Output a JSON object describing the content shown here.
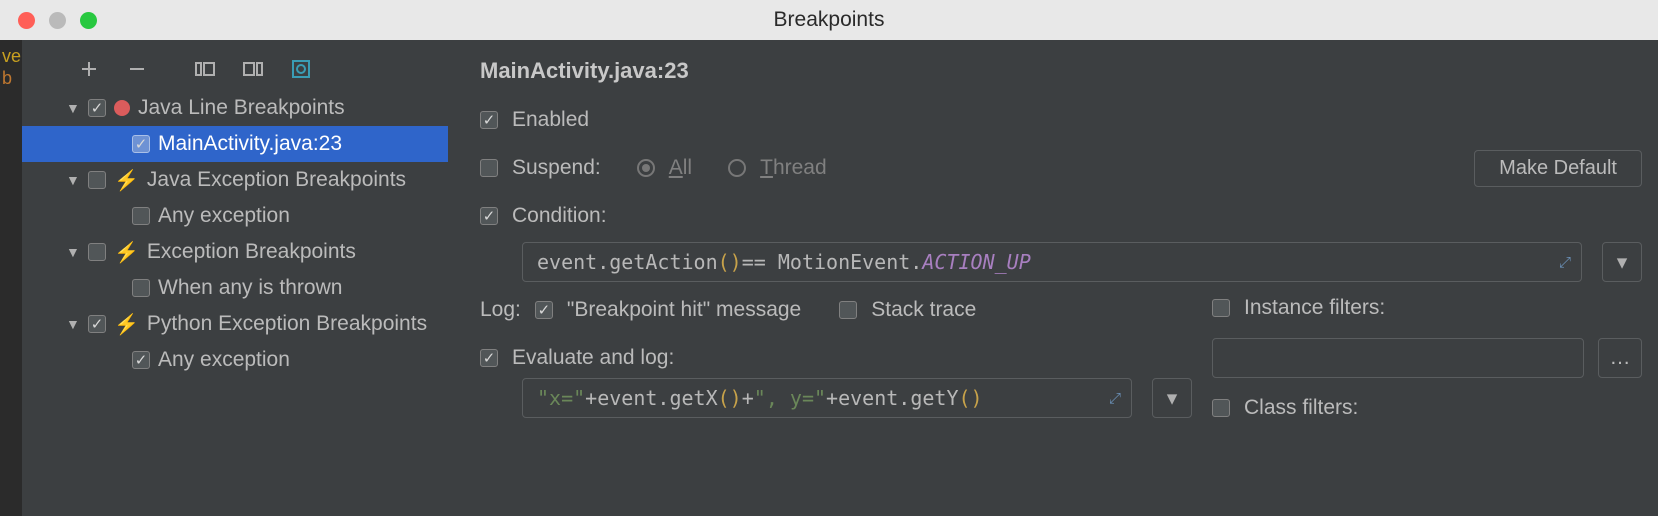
{
  "window": {
    "title": "Breakpoints"
  },
  "gutter": {
    "l1": "ve",
    "l2": "b"
  },
  "toolbar": {
    "add": "+",
    "remove": "−",
    "group": "⧈",
    "view": "⧉",
    "target": "◎"
  },
  "tree": {
    "groups": [
      {
        "label": "Java Line Breakpoints",
        "checked": true,
        "icon": "dot",
        "children": [
          {
            "label": "MainActivity.java:23",
            "checked": true,
            "selected": true
          }
        ]
      },
      {
        "label": "Java Exception Breakpoints",
        "checked": false,
        "icon": "bolt",
        "children": [
          {
            "label": "Any exception",
            "checked": false
          }
        ]
      },
      {
        "label": "Exception Breakpoints",
        "checked": false,
        "icon": "bolt",
        "children": [
          {
            "label": "When any is thrown",
            "checked": false
          }
        ]
      },
      {
        "label": "Python Exception Breakpoints",
        "checked": true,
        "icon": "bolt",
        "children": [
          {
            "label": "Any exception",
            "checked": true
          }
        ]
      }
    ]
  },
  "details": {
    "title": "MainActivity.java:23",
    "enabled_label": "Enabled",
    "enabled": true,
    "suspend_label": "Suspend:",
    "suspend_checked": false,
    "suspend_all": "All",
    "suspend_thread": "Thread",
    "make_default": "Make Default",
    "condition_label": "Condition:",
    "condition_checked": true,
    "condition_tokens": {
      "p1": "event",
      "p2": ".getAction",
      "p3": "()",
      "p4": " == MotionEvent.",
      "p5": "ACTION_UP"
    },
    "log_label": "Log:",
    "bp_hit_checked": true,
    "bp_hit_label": "\"Breakpoint hit\" message",
    "stack_checked": false,
    "stack_label": "Stack trace",
    "eval_checked": true,
    "eval_label": "Evaluate and log:",
    "eval_tokens": {
      "s1": "\"x=\"",
      "p1": "+event",
      "p2": ".getX",
      "p3": "()",
      "p4": "+",
      "s2": "\", y=\"",
      "p5": "+event",
      "p6": ".getY",
      "p7": "()"
    },
    "instance_filters_label": "Instance filters:",
    "instance_filters_checked": false,
    "class_filters_label": "Class filters:",
    "class_filters_checked": false
  }
}
